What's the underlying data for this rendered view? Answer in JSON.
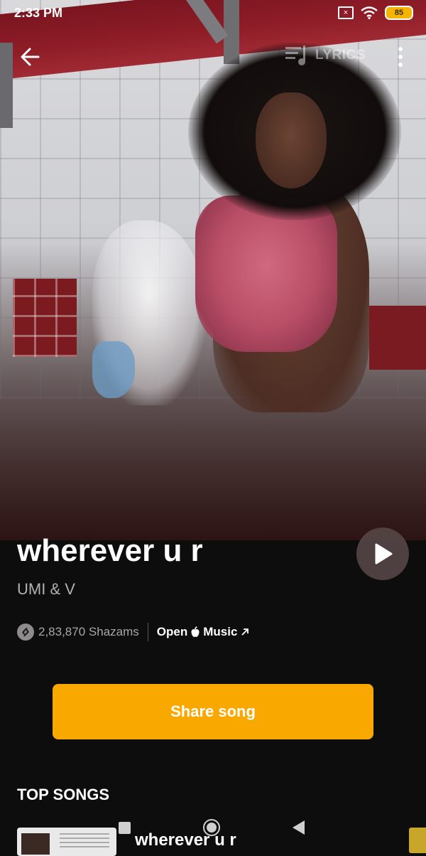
{
  "status_bar": {
    "time": "2:33 PM",
    "battery": "85"
  },
  "app_bar": {
    "lyrics_label": "LYRICS"
  },
  "song": {
    "title": "wherever u r",
    "artist": "UMI & V",
    "shazams": "2,83,870 Shazams",
    "open_label": "Open",
    "music_label": "Music"
  },
  "actions": {
    "share_label": "Share song"
  },
  "sections": {
    "top_songs_label": "TOP SONGS",
    "top_songs": [
      {
        "title": "wherever u r"
      }
    ]
  },
  "colors": {
    "accent": "#f9a800",
    "background": "#0d0d0d"
  },
  "icons": [
    "back-arrow-icon",
    "lyrics-icon",
    "more-vert-icon",
    "play-icon",
    "shazam-icon",
    "apple-icon",
    "external-link-icon",
    "wifi-icon",
    "sim-icon",
    "battery-icon"
  ]
}
